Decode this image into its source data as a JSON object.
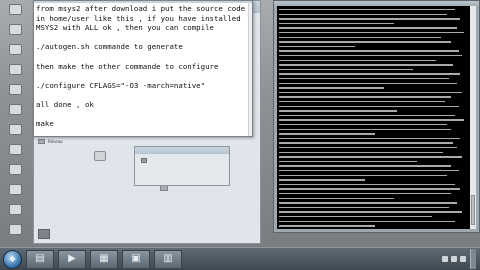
{
  "note": {
    "lines": [
      "from msys2 after download i put the source code",
      "in home/user like this , if you have installed",
      "MSYS2 with ALL ok , then you can compile",
      "",
      "./autogen.sh commande to generate",
      "",
      "then make the other commande to configure",
      "",
      "./configure CFLAGS=\"-O3 -march=native\"",
      "",
      "all done , ok",
      "",
      "make"
    ]
  },
  "desktop_icons": [
    {
      "label": "",
      "icon": "computer-icon"
    },
    {
      "label": "",
      "icon": "folder-icon"
    },
    {
      "label": "",
      "icon": "recycle-bin-icon"
    },
    {
      "label": "",
      "icon": "app-icon"
    },
    {
      "label": "",
      "icon": "app-icon"
    },
    {
      "label": "",
      "icon": "app-icon"
    },
    {
      "label": "",
      "icon": "app-icon"
    },
    {
      "label": "",
      "icon": "app-icon"
    },
    {
      "label": "",
      "icon": "app-icon"
    },
    {
      "label": "",
      "icon": "app-icon"
    },
    {
      "label": "",
      "icon": "app-icon"
    },
    {
      "label": "",
      "icon": "app-icon"
    }
  ],
  "explorer": {
    "nav_items": [
      "Réseau"
    ],
    "main_item": ""
  },
  "taskbar": {
    "start_glyph": "❖",
    "buttons": [
      {
        "icon": "folder-icon",
        "glyph": "▤"
      },
      {
        "icon": "media-icon",
        "glyph": "▶"
      },
      {
        "icon": "explorer-icon",
        "glyph": "▦"
      },
      {
        "icon": "terminal-icon",
        "glyph": "▣"
      },
      {
        "icon": "notepad-icon",
        "glyph": "▥"
      }
    ]
  },
  "colors": {
    "terminal_bg": "#000000",
    "terminal_text": "#c8c8c8",
    "note_bg": "#ffffff"
  }
}
